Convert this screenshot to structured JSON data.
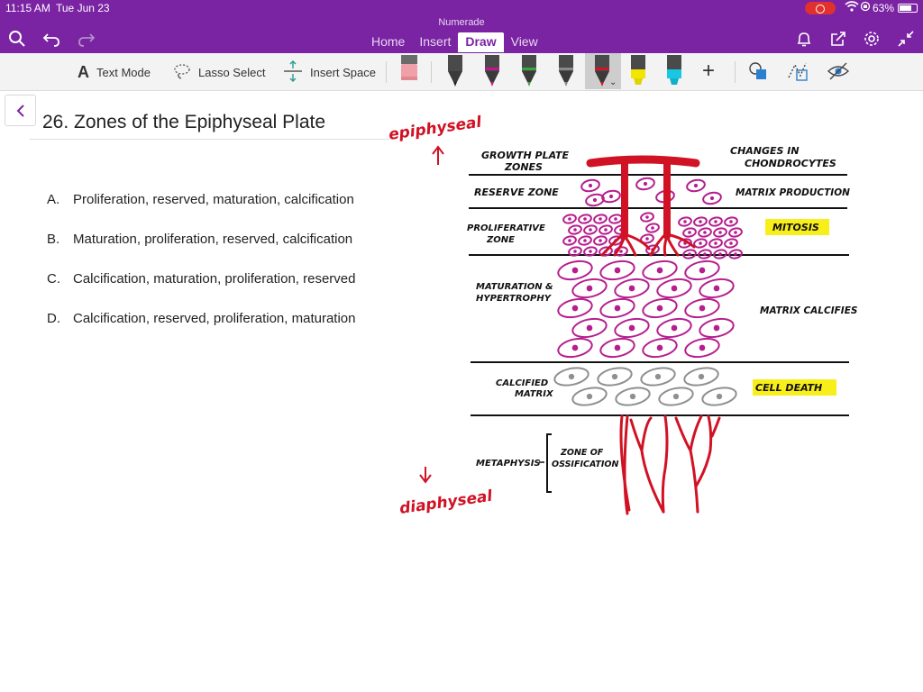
{
  "status_bar": {
    "time": "11:15 AM",
    "date": "Tue Jun 23",
    "battery_percent": "63%",
    "battery_level": 0.63
  },
  "app": {
    "name": "Numerade",
    "tabs": [
      {
        "label": "Home",
        "active": false
      },
      {
        "label": "Insert",
        "active": false
      },
      {
        "label": "Draw",
        "active": true
      },
      {
        "label": "View",
        "active": false
      }
    ],
    "accent_color": "#7a23a3"
  },
  "ribbon": {
    "text_mode_label": "Text Mode",
    "lasso_select_label": "Lasso Select",
    "insert_space_label": "Insert Space",
    "pens": [
      {
        "name": "eraser",
        "color": "#f0a0a8"
      },
      {
        "name": "black-pen",
        "color": "#222222"
      },
      {
        "name": "magenta-pen",
        "color": "#c0188c"
      },
      {
        "name": "green-pen",
        "color": "#3aa63a"
      },
      {
        "name": "gray-pen",
        "color": "#8a8a8a"
      },
      {
        "name": "red-pen",
        "color": "#d0142a"
      },
      {
        "name": "yellow-highlighter",
        "color": "#f2e600"
      },
      {
        "name": "cyan-highlighter",
        "color": "#19c8e0"
      }
    ]
  },
  "page": {
    "title": "26. Zones of the Epiphyseal Plate",
    "options": [
      {
        "letter": "A.",
        "text": "Proliferation, reserved, maturation, calcification"
      },
      {
        "letter": "B.",
        "text": "Maturation, proliferation, reserved, calcification"
      },
      {
        "letter": "C.",
        "text": "Calcification, maturation, proliferation, reserved"
      },
      {
        "letter": "D.",
        "text": "Calcification, reserved, proliferation, maturation"
      }
    ]
  },
  "diagram": {
    "annotation_top": "epiphyseal",
    "annotation_bottom": "diaphyseal",
    "header_left_line1": "GROWTH PLATE",
    "header_left_line2": "ZONES",
    "header_right_line1": "CHANGES IN",
    "header_right_line2": "CHONDROCYTES",
    "zones": {
      "reserve": "RESERVE ZONE",
      "proliferative_line1": "PROLIFERATIVE",
      "proliferative_line2": "ZONE",
      "maturation_line1": "MATURATION &",
      "maturation_line2": "HYPERTROPHY",
      "calcified_line1": "CALCIFIED",
      "calcified_line2": "MATRIX",
      "metaphysis": "METAPHYSIS",
      "ossification_line1": "ZONE OF",
      "ossification_line2": "OSSIFICATION"
    },
    "changes": {
      "matrix_production": "MATRIX PRODUCTION",
      "mitosis": "MITOSIS",
      "matrix_calcifies": "MATRIX CALCIFIES",
      "cell_death": "CELL DEATH"
    },
    "colors": {
      "vessel": "#d01224",
      "cell": "#b51e8e",
      "calcified_cell": "#8f8f8f",
      "highlight": "#f7ee1a"
    }
  }
}
